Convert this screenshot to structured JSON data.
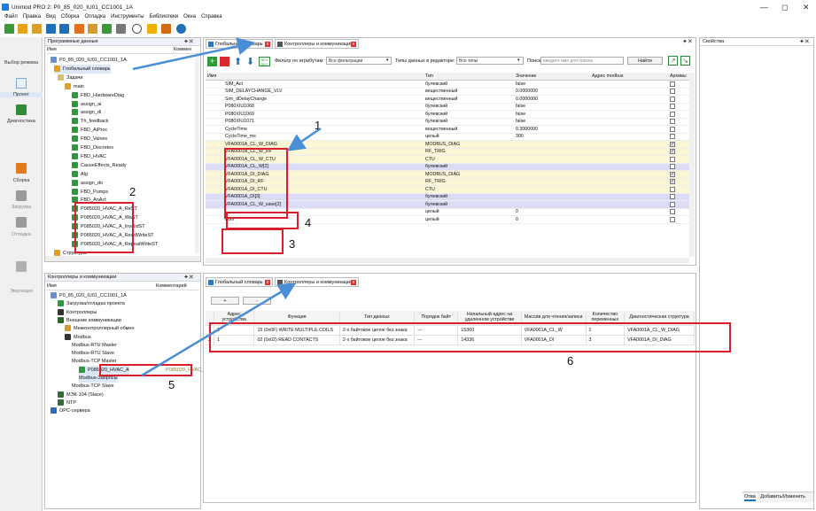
{
  "window": {
    "title": "Unimod PRO 2: P0_85_020_IU01_CC1001_1A",
    "controls": [
      "—",
      "◻",
      "✕"
    ]
  },
  "menu": [
    "Файл",
    "Правка",
    "Вид",
    "Сборка",
    "Отладка",
    "Инструменты",
    "Библиотеки",
    "Окна",
    "Справка"
  ],
  "sidebar": {
    "items": [
      {
        "label": "Выбор режима"
      },
      {
        "label": "Проект"
      },
      {
        "label": "Диагностика"
      },
      {
        "label": "Сборка"
      },
      {
        "label": "Загрузка"
      },
      {
        "label": "Отладка"
      },
      {
        "label": "Эмуляция"
      }
    ]
  },
  "program_panel": {
    "title": "Программные данные",
    "col_name": "Имя",
    "col_comment": "Коммен",
    "tree": [
      "P0_85_020_IU01_CC1001_1A",
      "Глобальный словарь",
      "Задачи",
      "main",
      "FBD_HardwareDiag",
      "assign_ai",
      "assign_di",
      "Th_feedback",
      "FBD_AiProc",
      "FBD_Valves",
      "FBD_Discretes",
      "FBD_HVAC",
      "CauseEffects_Ready",
      "Alg",
      "assign_do",
      "FBD_Pumps",
      "FBD_AnAct",
      "P085020_HVAC_A_ReST",
      "P085020_HVAC_A_WaST",
      "P085020_HVAC_A_InvalidST",
      "P085020_HVAC_A_ReadWriteST",
      "P085020_HVAC_A_RepeatWriteST",
      "Структуры"
    ]
  },
  "comm_panel": {
    "title": "Контроллеры и коммуникации",
    "col_name": "Имя",
    "col_comment": "Комментарий",
    "tree": [
      "P0_85_020_IU01_CC1001_1A",
      "Загрузка/отладка проекта",
      "Контроллеры",
      "Внешние коммуникации",
      "Межконтроллерный обмен",
      "Modbus",
      "Modbus-RTU Master",
      "Modbus-RTU Slave",
      "Modbus-TCP Master",
      "P085020_HVAC_A",
      "Modbus-Запросы",
      "Modbus-TCP Slave",
      "МЭК-104 (Slave)",
      "NTP",
      "OPC-сервера"
    ],
    "selected_comment": "P085020_HVAC_A"
  },
  "upper_tabs": [
    "Глобальный словарь",
    "Контроллеры и коммуникации"
  ],
  "filter": {
    "attr_label": "Фильтр по атрибутам:",
    "attr_value": "Все фильтрации",
    "types_label": "Типы данных в редакторе:",
    "types_value": "Все типы",
    "search_label": "Поиск:",
    "search_placeholder": "введите имя для поиска",
    "find_button": "Найти"
  },
  "global_dict": {
    "headers": [
      "Имя",
      "Тип",
      "Значение",
      "Адрес modbus",
      "Архивы"
    ],
    "rows": [
      {
        "name": "SIM_Act",
        "type": "булевский",
        "value": "false",
        "chk": false,
        "hl": ""
      },
      {
        "name": "SIM_DELAYCHANGE_VLV",
        "type": "вещественный",
        "value": "0.0000000",
        "chk": false,
        "hl": ""
      },
      {
        "name": "Sim_dDelayChange",
        "type": "вещественный",
        "value": "0.0000000",
        "chk": false,
        "hl": ""
      },
      {
        "name": "P080XIU1068",
        "type": "булевский",
        "value": "false",
        "chk": false,
        "hl": ""
      },
      {
        "name": "P080XIU1069",
        "type": "булевский",
        "value": "false",
        "chk": false,
        "hl": ""
      },
      {
        "name": "P080XIU1071",
        "type": "булевский",
        "value": "false",
        "chk": false,
        "hl": ""
      },
      {
        "name": "CycleTime",
        "type": "вещественный",
        "value": "0.3000000",
        "chk": false,
        "hl": ""
      },
      {
        "name": "CycleTime_ms",
        "type": "целый",
        "value": "300",
        "chk": false,
        "hl": ""
      },
      {
        "name": "VFA0001A_CL_W_DIAG",
        "type": "MODBUS_DIAG",
        "value": "",
        "chk": true,
        "hl": "y"
      },
      {
        "name": "VFA0001A_CL_W_RF",
        "type": "RF_TRIG",
        "value": "",
        "chk": true,
        "hl": "y"
      },
      {
        "name": "VFA0001A_CL_W_CTU",
        "type": "CTU",
        "value": "",
        "chk": false,
        "hl": "y"
      },
      {
        "name": "VFA0001A_CL_W[2]",
        "type": "булевский",
        "value": "",
        "chk": false,
        "hl": "b"
      },
      {
        "name": "VFA0001A_DI_DIAG",
        "type": "MODBUS_DIAG",
        "value": "",
        "chk": true,
        "hl": "y"
      },
      {
        "name": "VFA0001A_DI_RF",
        "type": "RF_TRIG",
        "value": "",
        "chk": true,
        "hl": "y"
      },
      {
        "name": "VFA0001A_DI_CTU",
        "type": "CTU",
        "value": "",
        "chk": false,
        "hl": "y"
      },
      {
        "name": "VFA0001A_DI[3]",
        "type": "булевский",
        "value": "",
        "chk": false,
        "hl": "b"
      },
      {
        "name": "VFA0001A_CL_W_save[2]",
        "type": "булевский",
        "value": "",
        "chk": false,
        "hl": "b"
      },
      {
        "name": "i",
        "type": "целый",
        "value": "0",
        "chk": false,
        "hl": ""
      },
      {
        "name": "num",
        "type": "целый",
        "value": "0",
        "chk": false,
        "hl": ""
      }
    ]
  },
  "lower_tabs": [
    "Глобальный словарь",
    "Контроллеры и коммуникации"
  ],
  "lower_buttons": [
    "+",
    "-"
  ],
  "modbus_table": {
    "headers": [
      "Адрес устройства",
      "Функция",
      "Тип данных",
      "Порядок байт",
      "Начальный адрес на удаленном устройстве",
      "Массив для чтения/записи",
      "Количество переменных",
      "Диагностическая структура"
    ],
    "rows": [
      {
        "n": "1",
        "addr": "1",
        "func": "15 (0x0F) WRITE MULTIPLE COILS",
        "dtype": "2-х байтовое целое без знака",
        "order": "---",
        "start": "15360",
        "array": "VFA0001A_CL_W",
        "count": "1",
        "diag": "VFA0001A_CL_W_DIAG"
      },
      {
        "n": "2",
        "addr": "1",
        "func": "02 (0x02) READ CONTACTS",
        "dtype": "2-х байтовое целое без знака",
        "order": "---",
        "start": "14336",
        "array": "VFA0001A_DI",
        "count": "3",
        "diag": "VFA0001A_DI_DIAG"
      }
    ]
  },
  "properties": {
    "title": "Свойства",
    "bottom_tabs": [
      "Отва",
      "Добавить/Изменить"
    ]
  },
  "annotations": [
    "1",
    "2",
    "3",
    "4",
    "5",
    "6"
  ]
}
